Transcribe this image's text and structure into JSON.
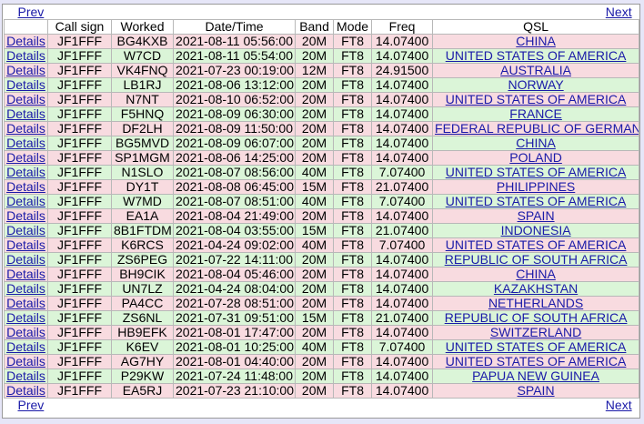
{
  "nav": {
    "prev": "Prev",
    "next": "Next"
  },
  "headers": [
    "",
    "Call sign",
    "Worked",
    "Date/Time",
    "Band",
    "Mode",
    "Freq",
    "QSL"
  ],
  "details_label": "Details",
  "rows": [
    {
      "call": "JF1FFF",
      "worked": "BG4KXB",
      "datetime": "2021-08-11 05:56:00",
      "band": "20M",
      "mode": "FT8",
      "freq": "14.07400",
      "qsl": "CHINA",
      "color": "pink"
    },
    {
      "call": "JF1FFF",
      "worked": "W7CD",
      "datetime": "2021-08-11 05:54:00",
      "band": "20M",
      "mode": "FT8",
      "freq": "14.07400",
      "qsl": "UNITED STATES OF AMERICA",
      "color": "green"
    },
    {
      "call": "JF1FFF",
      "worked": "VK4FNQ",
      "datetime": "2021-07-23 00:19:00",
      "band": "12M",
      "mode": "FT8",
      "freq": "24.91500",
      "qsl": "AUSTRALIA",
      "color": "pink"
    },
    {
      "call": "JF1FFF",
      "worked": "LB1RJ",
      "datetime": "2021-08-06 13:12:00",
      "band": "20M",
      "mode": "FT8",
      "freq": "14.07400",
      "qsl": "NORWAY",
      "color": "green"
    },
    {
      "call": "JF1FFF",
      "worked": "N7NT",
      "datetime": "2021-08-10 06:52:00",
      "band": "20M",
      "mode": "FT8",
      "freq": "14.07400",
      "qsl": "UNITED STATES OF AMERICA",
      "color": "pink"
    },
    {
      "call": "JF1FFF",
      "worked": "F5HNQ",
      "datetime": "2021-08-09 06:30:00",
      "band": "20M",
      "mode": "FT8",
      "freq": "14.07400",
      "qsl": "FRANCE",
      "color": "green"
    },
    {
      "call": "JF1FFF",
      "worked": "DF2LH",
      "datetime": "2021-08-09 11:50:00",
      "band": "20M",
      "mode": "FT8",
      "freq": "14.07400",
      "qsl": "FEDERAL REPUBLIC OF GERMANY",
      "color": "pink"
    },
    {
      "call": "JF1FFF",
      "worked": "BG5MVD",
      "datetime": "2021-08-09 06:07:00",
      "band": "20M",
      "mode": "FT8",
      "freq": "14.07400",
      "qsl": "CHINA",
      "color": "green"
    },
    {
      "call": "JF1FFF",
      "worked": "SP1MGM",
      "datetime": "2021-08-06 14:25:00",
      "band": "20M",
      "mode": "FT8",
      "freq": "14.07400",
      "qsl": "POLAND",
      "color": "pink"
    },
    {
      "call": "JF1FFF",
      "worked": "N1SLO",
      "datetime": "2021-08-07 08:56:00",
      "band": "40M",
      "mode": "FT8",
      "freq": "7.07400",
      "qsl": "UNITED STATES OF AMERICA",
      "color": "green"
    },
    {
      "call": "JF1FFF",
      "worked": "DY1T",
      "datetime": "2021-08-08 06:45:00",
      "band": "15M",
      "mode": "FT8",
      "freq": "21.07400",
      "qsl": "PHILIPPINES",
      "color": "pink"
    },
    {
      "call": "JF1FFF",
      "worked": "W7MD",
      "datetime": "2021-08-07 08:51:00",
      "band": "40M",
      "mode": "FT8",
      "freq": "7.07400",
      "qsl": "UNITED STATES OF AMERICA",
      "color": "green"
    },
    {
      "call": "JF1FFF",
      "worked": "EA1A",
      "datetime": "2021-08-04 21:49:00",
      "band": "20M",
      "mode": "FT8",
      "freq": "14.07400",
      "qsl": "SPAIN",
      "color": "pink"
    },
    {
      "call": "JF1FFF",
      "worked": "8B1FTDM",
      "datetime": "2021-08-04 03:55:00",
      "band": "15M",
      "mode": "FT8",
      "freq": "21.07400",
      "qsl": "INDONESIA",
      "color": "green"
    },
    {
      "call": "JF1FFF",
      "worked": "K6RCS",
      "datetime": "2021-04-24 09:02:00",
      "band": "40M",
      "mode": "FT8",
      "freq": "7.07400",
      "qsl": "UNITED STATES OF AMERICA",
      "color": "pink"
    },
    {
      "call": "JF1FFF",
      "worked": "ZS6PEG",
      "datetime": "2021-07-22 14:11:00",
      "band": "20M",
      "mode": "FT8",
      "freq": "14.07400",
      "qsl": "REPUBLIC OF SOUTH AFRICA",
      "color": "green"
    },
    {
      "call": "JF1FFF",
      "worked": "BH9CIK",
      "datetime": "2021-08-04 05:46:00",
      "band": "20M",
      "mode": "FT8",
      "freq": "14.07400",
      "qsl": "CHINA",
      "color": "pink"
    },
    {
      "call": "JF1FFF",
      "worked": "UN7LZ",
      "datetime": "2021-04-24 08:04:00",
      "band": "20M",
      "mode": "FT8",
      "freq": "14.07400",
      "qsl": "KAZAKHSTAN",
      "color": "green"
    },
    {
      "call": "JF1FFF",
      "worked": "PA4CC",
      "datetime": "2021-07-28 08:51:00",
      "band": "20M",
      "mode": "FT8",
      "freq": "14.07400",
      "qsl": "NETHERLANDS",
      "color": "pink"
    },
    {
      "call": "JF1FFF",
      "worked": "ZS6NL",
      "datetime": "2021-07-31 09:51:00",
      "band": "15M",
      "mode": "FT8",
      "freq": "21.07400",
      "qsl": "REPUBLIC OF SOUTH AFRICA",
      "color": "green"
    },
    {
      "call": "JF1FFF",
      "worked": "HB9EFK",
      "datetime": "2021-08-01 17:47:00",
      "band": "20M",
      "mode": "FT8",
      "freq": "14.07400",
      "qsl": "SWITZERLAND",
      "color": "pink"
    },
    {
      "call": "JF1FFF",
      "worked": "K6EV",
      "datetime": "2021-08-01 10:25:00",
      "band": "40M",
      "mode": "FT8",
      "freq": "7.07400",
      "qsl": "UNITED STATES OF AMERICA",
      "color": "green"
    },
    {
      "call": "JF1FFF",
      "worked": "AG7HY",
      "datetime": "2021-08-01 04:40:00",
      "band": "20M",
      "mode": "FT8",
      "freq": "14.07400",
      "qsl": "UNITED STATES OF AMERICA",
      "color": "pink"
    },
    {
      "call": "JF1FFF",
      "worked": "P29KW",
      "datetime": "2021-07-24 11:48:00",
      "band": "20M",
      "mode": "FT8",
      "freq": "14.07400",
      "qsl": "PAPUA NEW GUINEA",
      "color": "green"
    },
    {
      "call": "JF1FFF",
      "worked": "EA5RJ",
      "datetime": "2021-07-23 21:10:00",
      "band": "20M",
      "mode": "FT8",
      "freq": "14.07400",
      "qsl": "SPAIN",
      "color": "pink"
    }
  ]
}
